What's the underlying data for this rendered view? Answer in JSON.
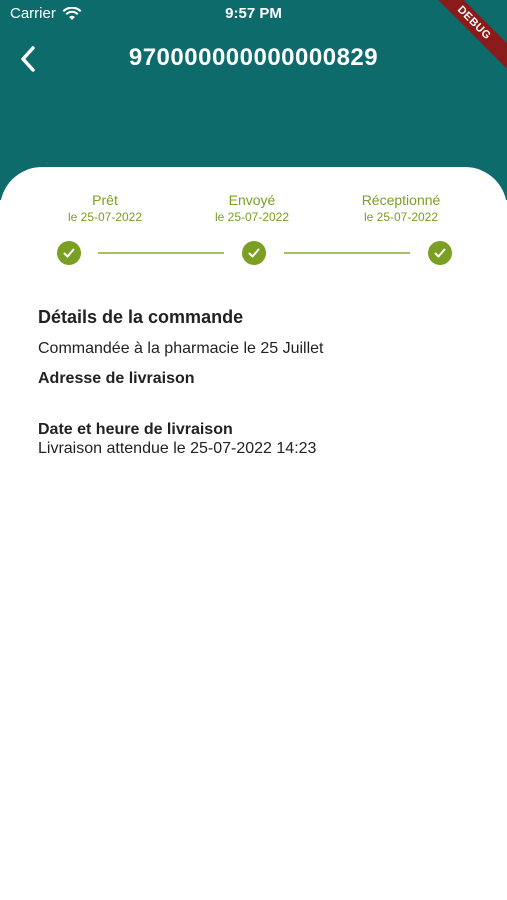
{
  "status_bar": {
    "carrier": "Carrier",
    "time": "9:57 PM"
  },
  "debug_banner": "DEBUG",
  "header": {
    "title": "970000000000000829",
    "background_color": "#0d6b6b"
  },
  "tracker": {
    "accent_color": "#7a9f23",
    "steps": [
      {
        "label": "Prêt",
        "date": "le 25-07-2022"
      },
      {
        "label": "Envoyé",
        "date": "le 25-07-2022"
      },
      {
        "label": "Réceptionné",
        "date": "le 25-07-2022"
      }
    ]
  },
  "details": {
    "title": "Détails de la commande",
    "ordered_text": "Commandée à la pharmacie le 25 Juillet",
    "address_title": "Adresse de livraison",
    "delivery_datetime_title": "Date et heure de livraison",
    "delivery_datetime_text": "Livraison attendue le 25-07-2022 14:23"
  }
}
